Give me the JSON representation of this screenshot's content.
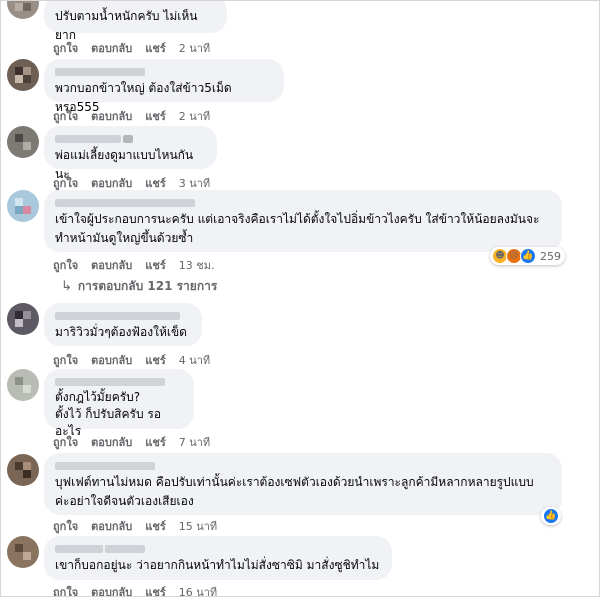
{
  "actions": {
    "like": "ถูกใจ",
    "reply": "ตอบกลับ",
    "share": "แชร์"
  },
  "comments": [
    {
      "text": "ปรับตามน้ำหนักครับ ไม่เห็นยาก",
      "time": "2 นาที"
    },
    {
      "text": "พวกบอกข้าวใหญ่ ต้องใส่ข้าว5เม็ดหรอ555",
      "time": "2 นาที"
    },
    {
      "text": "พ่อแม่เลี้ยงดูมาแบบไหนกันนะ",
      "time": "3 นาที"
    },
    {
      "text": "เข้าใจผู้ประกอบการนะครับ แต่เอาจริงคือเราไม่ได้ตั้งใจไปอิ่มข้าวไงครับ ใส่ข้าวให้น้อยลงมันจะ\nทำหน้ามันดูใหญ่ขึ้นด้วยซ้ำ",
      "time": "13 ชม.",
      "reaction_count": "259",
      "reactions": [
        "haha-icon",
        "angry-icon",
        "like-icon"
      ]
    },
    {
      "text": "มาริวิวมั่วๆต้องฟ้องให้เข็ด",
      "time": "4 นาที"
    },
    {
      "text": "ตั้งกฎไว้มั้ยครับ?\nตั้งไว้ ก็ปรับสิครับ รออะไร",
      "time": "7 นาที"
    },
    {
      "text": "บุฟเฟต์ทานไม่หมด คือปรับเท่านั้นค่ะเราต้องเซฟตัวเองด้วยนำเพราะลูกค้ามีหลากหลายรูปแบบ\nค่ะอย่าใจดีจนตัวเองเสียเอง",
      "time": "15 นาที",
      "reactions": [
        "like-icon"
      ]
    },
    {
      "text": "เขาก็บอกอยู่นะ ว่าอยากกินหน้าทำไมไม่สั่งซาซิมิ มาสั่งซูชิทำไม",
      "time": "16 นาที"
    }
  ],
  "replies_link": "การตอบกลับ 121 รายการ",
  "colors": {
    "bubble": "#f0f2f5",
    "meta": "#65676b",
    "like_blue": "#1877f2"
  }
}
